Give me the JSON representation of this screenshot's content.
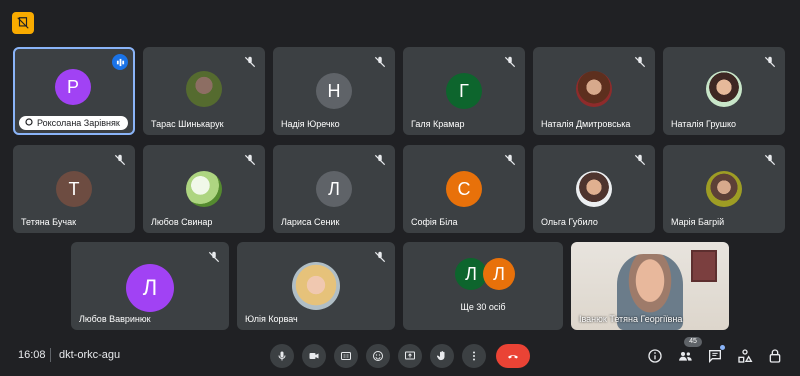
{
  "meeting": {
    "time": "16:08",
    "code": "dkt-orkc-agu",
    "participant_count": "45"
  },
  "colors": {
    "accent": "#8ab4f8",
    "hangup": "#ea4335",
    "tile_bg": "#3c4043",
    "badge": "#f9ab00"
  },
  "tiles": [
    {
      "name": "Роксолана Зарівняк",
      "initial": "Р",
      "color": "#a142f4",
      "speaking": true
    },
    {
      "name": "Тарас Шинькарук",
      "photo": true
    },
    {
      "name": "Надія Юречко",
      "initial": "Н",
      "color": "#5f6368"
    },
    {
      "name": "Галя Крамар",
      "initial": "Г",
      "color": "#0d652d"
    },
    {
      "name": "Наталія Дмитровська",
      "photo": true
    },
    {
      "name": "Наталія Грушко",
      "photo": true
    },
    {
      "name": "Тетяна Бучак",
      "initial": "Т",
      "color": "#6d4c41"
    },
    {
      "name": "Любов Свинар",
      "photo": true
    },
    {
      "name": "Лариса Сеник",
      "initial": "Л",
      "color": "#5f6368"
    },
    {
      "name": "Софія Біла",
      "initial": "С",
      "color": "#e8710a"
    },
    {
      "name": "Ольга Губило",
      "photo": true
    },
    {
      "name": "Марія Багрій",
      "photo": true
    },
    {
      "name": "Любов Ваврин­юк",
      "initial": "Л",
      "color": "#a142f4"
    },
    {
      "name": "Юлія Корвач",
      "photo": true
    },
    {
      "name": "Ще 30 осіб",
      "initials": [
        "Л",
        "Л"
      ],
      "colors": [
        "#0d652d",
        "#e8710a"
      ]
    },
    {
      "name": "Іванюк Тетяна Георгіївна",
      "video": true
    }
  ],
  "icons": {
    "top_badge": "hand-off-icon",
    "mic_off": "mic-off-icon",
    "mic": "mic-icon",
    "camera": "camera-icon",
    "captions": "captions-icon",
    "emoji": "emoji-icon",
    "present": "present-icon",
    "hand": "raise-hand-icon",
    "more": "more-options-icon",
    "hangup": "hangup-icon",
    "info": "info-icon",
    "people": "people-icon",
    "chat": "chat-icon",
    "activities": "activities-icon",
    "lock": "host-controls-icon"
  }
}
